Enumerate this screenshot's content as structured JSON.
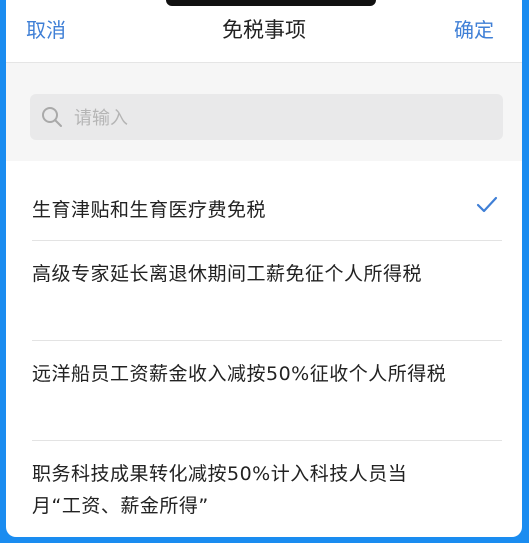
{
  "header": {
    "cancel_label": "取消",
    "title": "免税事项",
    "confirm_label": "确定"
  },
  "search": {
    "placeholder": "请输入",
    "value": ""
  },
  "items": [
    {
      "label": "生育津贴和生育医疗费免税",
      "selected": true
    },
    {
      "label": "高级专家延长离退休期间工薪免征个人所得税",
      "selected": false
    },
    {
      "label": "远洋船员工资薪金收入减按50%征收个人所得税",
      "selected": false
    },
    {
      "label": "职务科技成果转化减按50%计入科技人员当月“工资、薪金所得”",
      "selected": false
    }
  ],
  "colors": {
    "accent": "#3f7fd6",
    "frame": "#1a8cf0"
  }
}
